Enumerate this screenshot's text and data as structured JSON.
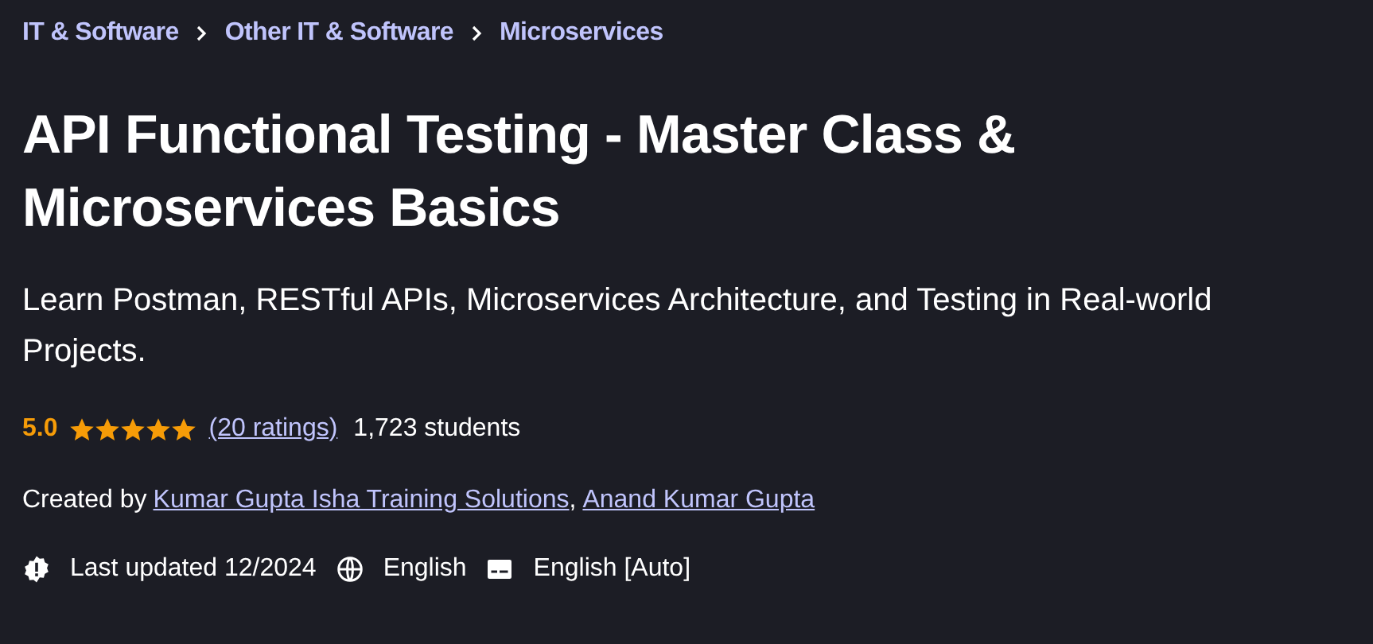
{
  "breadcrumbs": [
    {
      "label": "IT & Software"
    },
    {
      "label": "Other IT & Software"
    },
    {
      "label": "Microservices"
    }
  ],
  "title": "API Functional Testing - Master Class & Microservices Basics",
  "subtitle": "Learn Postman, RESTful APIs, Microservices Architecture, and Testing in Real-world Projects.",
  "rating": {
    "score": "5.0",
    "stars": 5,
    "ratings_link": "(20 ratings)",
    "students": "1,723 students"
  },
  "created_by": {
    "label": "Created by",
    "separator": ",",
    "authors": [
      "Kumar Gupta Isha Training Solutions",
      "Anand Kumar Gupta"
    ]
  },
  "meta": [
    {
      "kind": "updated",
      "text": "Last updated 12/2024"
    },
    {
      "kind": "language",
      "text": "English"
    },
    {
      "kind": "captions",
      "text": "English [Auto]"
    }
  ]
}
